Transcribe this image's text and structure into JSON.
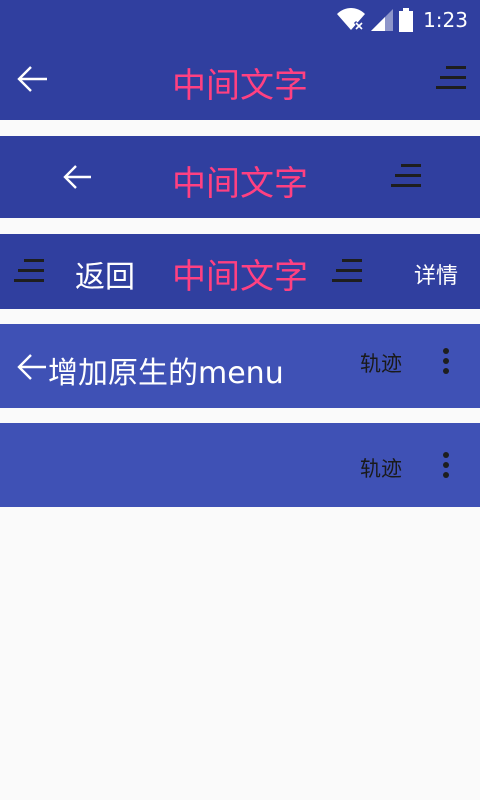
{
  "status": {
    "time": "1:23"
  },
  "bar1": {
    "title": "中间文字"
  },
  "bar2": {
    "title": "中间文字"
  },
  "bar3": {
    "left_text": "返回",
    "title": "中间文字",
    "right_text": "详情"
  },
  "bar4": {
    "title": "增加原生的menu",
    "menu_label": "轨迹"
  },
  "bar5": {
    "menu_label": "轨迹"
  },
  "colors": {
    "primary_dark": "#303f9f",
    "primary": "#3f51b5",
    "accent": "#ff4081",
    "background": "#fafafa"
  },
  "icons": [
    "wifi-icon",
    "signal-icon",
    "battery-icon",
    "back-arrow-icon",
    "menu-lines-icon",
    "more-vert-icon"
  ]
}
